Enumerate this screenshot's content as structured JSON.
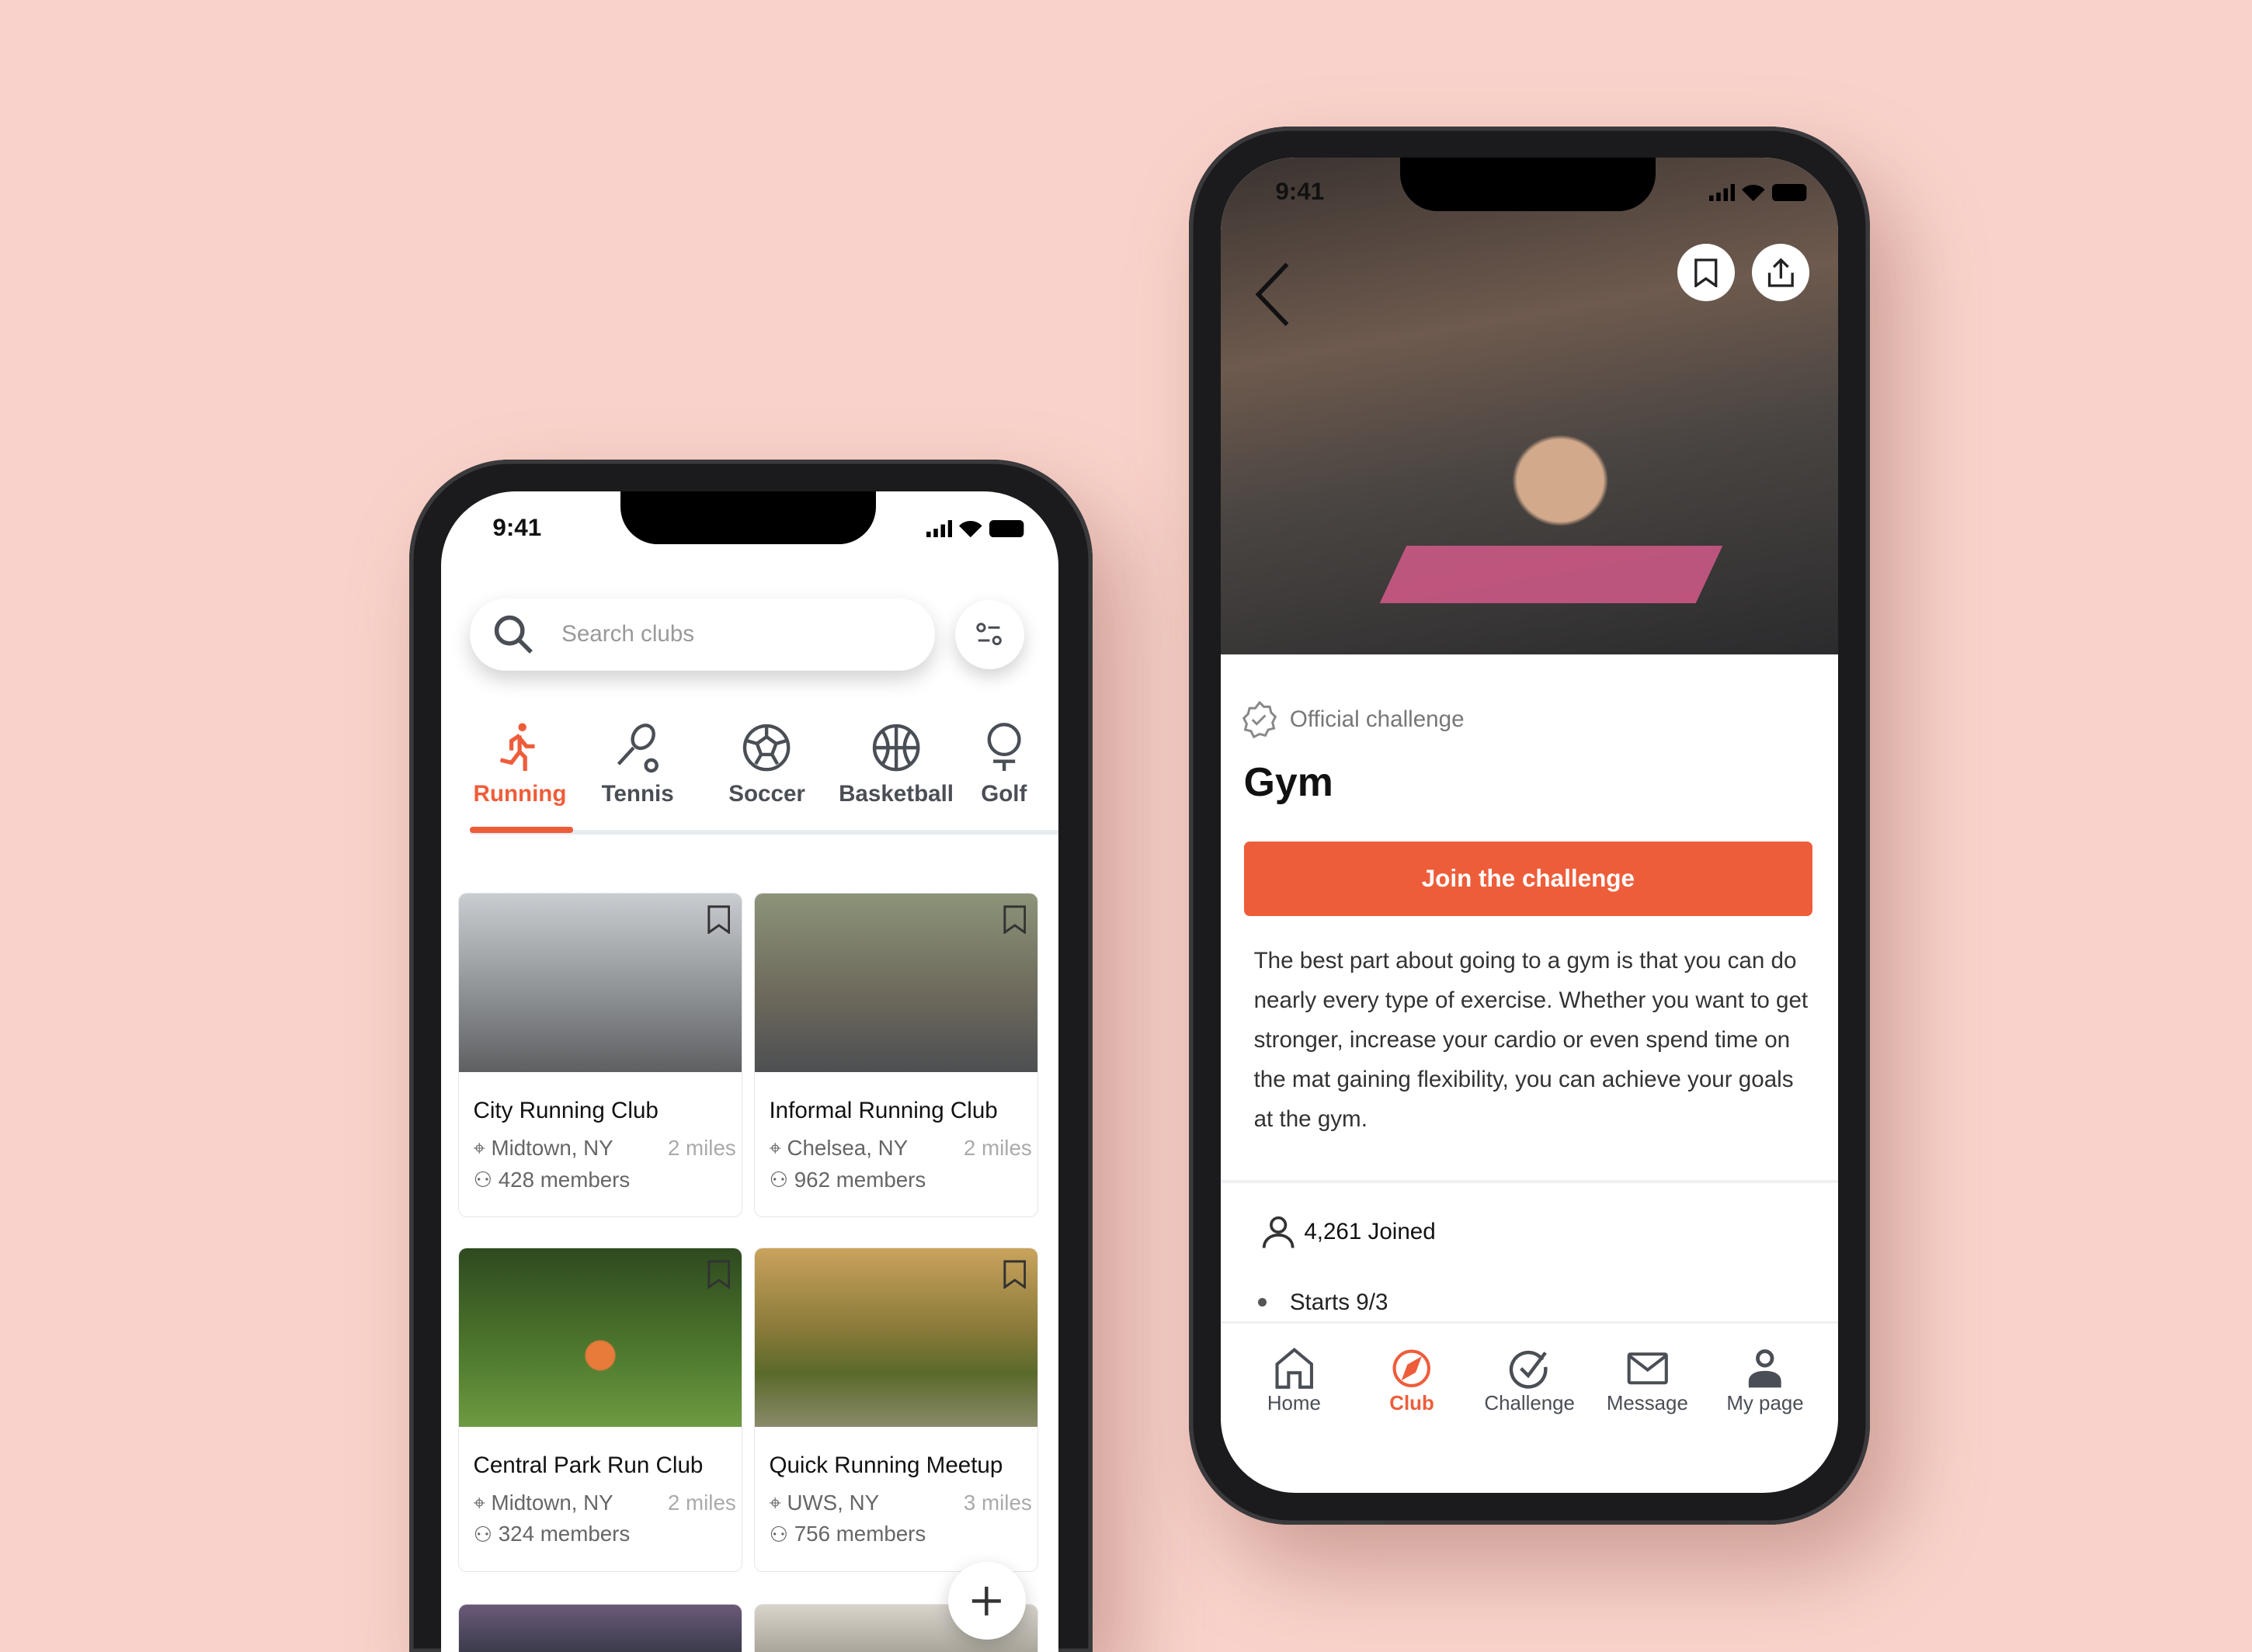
{
  "left_phone": {
    "status_time": "9:41",
    "search": {
      "placeholder": "Search clubs",
      "icon": "search-icon"
    },
    "filter_icon": "sliders-icon",
    "categories": [
      {
        "label": "Running",
        "icon": "running-icon",
        "active": true
      },
      {
        "label": "Tennis",
        "icon": "tennis-icon"
      },
      {
        "label": "Soccer",
        "icon": "soccer-icon"
      },
      {
        "label": "Basketball",
        "icon": "basketball-icon"
      },
      {
        "label": "Golf",
        "icon": "golf-icon"
      }
    ],
    "clubs": [
      {
        "name": "City Running Club",
        "location": "Midtown, NY",
        "distance": "2 miles",
        "members": "428 members"
      },
      {
        "name": "Informal Running Club",
        "location": "Chelsea, NY",
        "distance": "2 miles",
        "members": "962 members"
      },
      {
        "name": "Central Park Run Club",
        "location": "Midtown, NY",
        "distance": "2 miles",
        "members": "324 members"
      },
      {
        "name": "Quick Running Meetup",
        "location": "UWS, NY",
        "distance": "3 miles",
        "members": "756 members"
      }
    ],
    "fab_icon": "plus-icon"
  },
  "right_phone": {
    "status_time": "9:41",
    "badge": "Official challenge",
    "title": "Gym",
    "cta": "Join the challenge",
    "description": "The best part about going to a gym is that you can do nearly every type of exercise. Whether you want to get stronger, increase your cardio or even spend time on the mat gaining flexibility, you can achieve your goals at the gym.",
    "joined": "4,261 Joined",
    "starts": "Starts 9/3",
    "nav": [
      {
        "label": "Home",
        "icon": "home-icon"
      },
      {
        "label": "Club",
        "icon": "compass-icon",
        "active": true
      },
      {
        "label": "Challenge",
        "icon": "check-circle-icon"
      },
      {
        "label": "Message",
        "icon": "mail-icon"
      },
      {
        "label": "My page",
        "icon": "user-icon"
      }
    ]
  },
  "colors": {
    "accent": "#EE5D3A",
    "background": "#F9D3CB",
    "icon": "#4A4E55"
  }
}
